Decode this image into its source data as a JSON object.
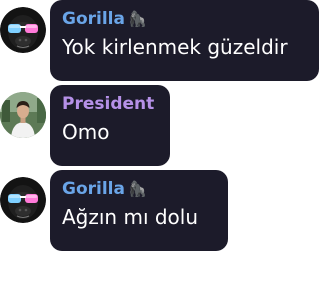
{
  "messages": [
    {
      "sender": "Gorilla",
      "sender_emoji": "🦍",
      "sender_color": "#6aa5e8",
      "text": "Yok kirlenmek güzeldir",
      "avatar_icon": "gorilla-sunglasses-avatar-icon"
    },
    {
      "sender": "President",
      "sender_emoji": "",
      "sender_color": "#b691e8",
      "text": "Omo",
      "avatar_icon": "user-photo-avatar-icon"
    },
    {
      "sender": "Gorilla",
      "sender_emoji": "🦍",
      "sender_color": "#6aa5e8",
      "text": "Ağzın mı dolu",
      "avatar_icon": "gorilla-sunglasses-avatar-icon"
    }
  ],
  "bubble_color": "#1c1b2a"
}
